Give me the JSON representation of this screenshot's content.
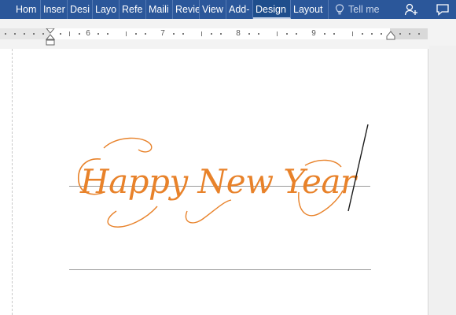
{
  "ribbon": {
    "tabs": [
      {
        "label": "Hom"
      },
      {
        "label": "Inser"
      },
      {
        "label": "Desi"
      },
      {
        "label": "Layo"
      },
      {
        "label": "Refe"
      },
      {
        "label": "Maili"
      },
      {
        "label": "Revie"
      },
      {
        "label": "View"
      },
      {
        "label": "Add-"
      },
      {
        "label": "Design"
      },
      {
        "label": "Layout"
      }
    ],
    "tell_me": "Tell me",
    "colors": {
      "bar": "#2b579a",
      "active": "#1e4e8c"
    }
  },
  "ruler": {
    "numbers": [
      "6",
      "7",
      "8",
      "9"
    ]
  },
  "document": {
    "headline": "Happy New Year",
    "text_color": "#e8822a"
  },
  "icons": {
    "tell_me": "lightbulb-icon",
    "share": "share-person-icon",
    "comment": "comment-icon"
  }
}
